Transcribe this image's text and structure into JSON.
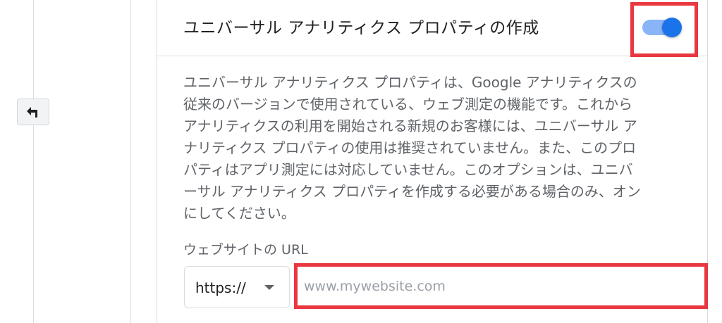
{
  "card": {
    "title": "ユニバーサル アナリティクス プロパティの作成",
    "toggle": {
      "state": "on",
      "color": "#1a73e8"
    }
  },
  "description": {
    "lines": [
      "ユニバーサル アナリティクス プロパティは、Google アナリティクスの",
      "従来のバージョンで使用されている、ウェブ測定の機能です。これから",
      "アナリティクスの利用を開始される新規のお客様には、ユニバーサル ア",
      "ナリティクス プロパティの使用は推奨されていません。また、このプロ",
      "パティはアプリ測定には対応していません。このオプションは、ユニバ",
      "ーサル アナリティクス プロパティを作成する必要がある場合のみ、オン",
      "にしてください。"
    ]
  },
  "url_field": {
    "label": "ウェブサイトの URL",
    "protocol": "https://",
    "placeholder": "www.mywebsite.com",
    "value": ""
  },
  "icons": {
    "back": "back-arrow-icon",
    "dropdown": "dropdown-arrow-icon"
  },
  "colors": {
    "highlight": "#e8373f",
    "accent": "#1a73e8"
  }
}
